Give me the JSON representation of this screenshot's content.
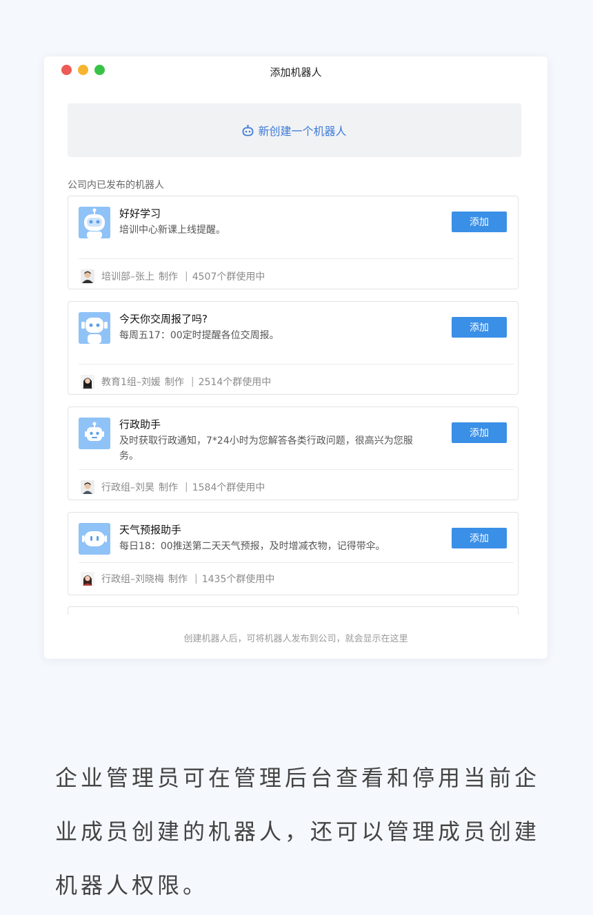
{
  "window": {
    "title": "添加机器人",
    "new_bot_label": "新创建一个机器人",
    "section_label": "公司内已发布的机器人",
    "footer_hint": "创建机器人后，可将机器人发布到公司，就会显示在这里"
  },
  "bots": [
    {
      "name": "好好学习",
      "desc": "培训中心新课上线提醒。",
      "add_label": "添加",
      "maker": "培训部–张上",
      "made_label": "制作",
      "sep": "|",
      "usage": "4507个群使用中"
    },
    {
      "name": "今天你交周报了吗?",
      "desc": "每周五17：00定时提醒各位交周报。",
      "add_label": "添加",
      "maker": "教育1组–刘媛",
      "made_label": "制作",
      "sep": "|",
      "usage": "2514个群使用中"
    },
    {
      "name": "行政助手",
      "desc": "及时获取行政通知，7*24小时为您解答各类行政问题，很高兴为您服务。",
      "add_label": "添加",
      "maker": "行政组–刘昊",
      "made_label": "制作",
      "sep": "|",
      "usage": "1584个群使用中"
    },
    {
      "name": "天气预报助手",
      "desc": "每日18：00推送第二天天气预报，及时增减衣物，记得带伞。",
      "add_label": "添加",
      "maker": "行政组–刘晓梅",
      "made_label": "制作",
      "sep": "|",
      "usage": "1435个群使用中"
    }
  ],
  "colors": {
    "accent": "#3a8fe6",
    "link": "#3c7ad8",
    "avatar_bg": "#8fc2f7"
  },
  "caption": "企业管理员可在管理后台查看和停用当前企业成员创建的机器人，还可以管理成员创建机器人权限。"
}
